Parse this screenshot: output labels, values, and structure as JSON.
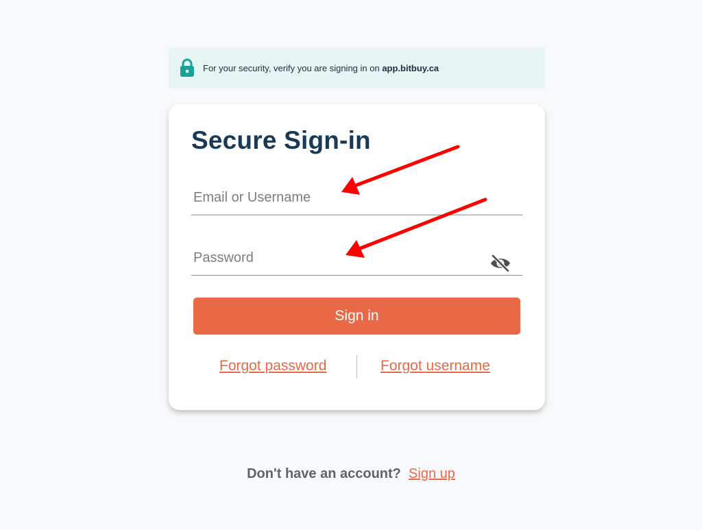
{
  "banner": {
    "text": "For your security, verify you are signing in on ",
    "domain": "app.bitbuy.ca",
    "icon": "lock-icon"
  },
  "card": {
    "title": "Secure Sign-in",
    "email": {
      "placeholder": "Email or Username",
      "value": ""
    },
    "password": {
      "placeholder": "Password",
      "value": "",
      "toggle_icon": "eye-off-icon"
    },
    "signin_label": "Sign in",
    "forgot_password": "Forgot password",
    "forgot_username": "Forgot username"
  },
  "footer": {
    "question": "Don't have an account?",
    "signup_label": "Sign up"
  },
  "colors": {
    "accent": "#e96846",
    "title": "#183a55",
    "banner_bg": "#e6f5f3",
    "lock": "#17a398",
    "annotation": "#ff0000"
  }
}
